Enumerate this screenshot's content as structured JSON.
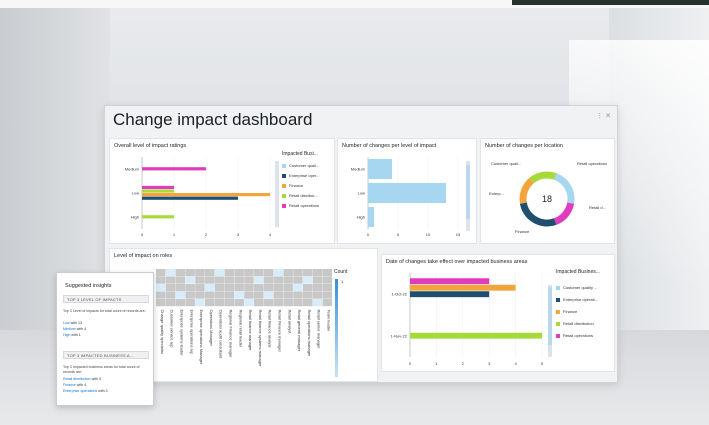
{
  "dashboard": {
    "title": "Change impact dashboard",
    "menu": "⋮ ✕"
  },
  "ratings": {
    "title": "Overall level of impact ratings",
    "legend_title": "Impacted Busi...",
    "legend": [
      "Customer quali...",
      "Enterprise oper...",
      "Finance",
      "Retail distribut...",
      "Retail operations"
    ]
  },
  "changes_impact": {
    "title": "Number of changes per level of impact"
  },
  "changes_location": {
    "title": "Number of changes per location",
    "center_value": "18",
    "labels": {
      "customer": "Customer quali...",
      "retail_ops": "Retail operations",
      "retail_dist": "Retail d...",
      "enterprise": "Enterp...",
      "finance": "Finance"
    }
  },
  "roles": {
    "title": "Level of impact on roles",
    "count_label": "Count",
    "count_value": "1",
    "roles": [
      "Change quality specialist",
      "Customer service rep",
      "Enterprise systems leader",
      "Enterprise operations rep",
      "Enterprise operations Manager",
      "Operations Manager",
      "Operations audit consultant",
      "Regional Finance manager",
      "Regional retail leader",
      "Retail finance manager",
      "Retail finance systems manager",
      "Retail finance analyst",
      "Retail Finance manager",
      "Retail analyst",
      "Retail general manager",
      "Retail operations manager",
      "Retail senior manager",
      "Team leader"
    ]
  },
  "dates": {
    "title": "Date of changes take effect over impacted business areas",
    "legend_title": "Impacted Busines...",
    "legend": [
      "Customer quality ...",
      "Enterprise operati...",
      "Finance",
      "Retail distribution",
      "Retail operations"
    ]
  },
  "insights": {
    "heading": "Suggested insights",
    "chip1": "TOP 3 LEVEL OF IMPACTS",
    "para1": "Top 3 Level of impacts for total count of records are:",
    "l1a": "Low",
    "l1b": " with 13",
    "l2a": "Medium",
    "l2b": " with 4",
    "l3a": "High",
    "l3b": " with 1",
    "chip2": "TOP 3 IMPACTED BUSINESS A...",
    "para2": "Top 3 Impacted business areas for total count of records are:",
    "m1a": "Retail distribution",
    "m1b": " with 5",
    "m2a": "Finance",
    "m2b": " with 4",
    "m3a": "Enterprise operations",
    "m3b": " with 3"
  },
  "colors": {
    "customer": "#a7d7f0",
    "enterprise": "#1f4e6e",
    "finance": "#f2a53a",
    "retail_dist": "#a8d93a",
    "retail_ops": "#e13bc0"
  },
  "chart_data": [
    {
      "type": "bar",
      "title": "Overall level of impact ratings",
      "orientation": "horizontal",
      "categories": [
        "Medium",
        "Low",
        "High"
      ],
      "xticks": [
        "0",
        "1",
        "2",
        "3",
        "4"
      ],
      "legend_title": "Impacted Busi...",
      "series": [
        {
          "name": "Retail operations",
          "values": [
            2,
            1,
            0
          ]
        },
        {
          "name": "Retail distribut...",
          "values": [
            0,
            1,
            1
          ]
        },
        {
          "name": "Finance",
          "values": [
            0,
            4,
            0
          ]
        },
        {
          "name": "Enterprise opera...",
          "values": [
            0,
            3,
            0
          ]
        },
        {
          "name": "Customer quali...",
          "values": [
            0,
            0,
            0
          ]
        }
      ]
    },
    {
      "type": "bar",
      "title": "Number of changes per level of impact",
      "orientation": "horizontal",
      "categories": [
        "Medium",
        "Low",
        "High"
      ],
      "values": [
        4,
        13,
        1
      ],
      "xticks": [
        "0",
        "5",
        "10",
        "15"
      ]
    },
    {
      "type": "pie",
      "title": "Number of changes per location",
      "center_label": "18",
      "labels": [
        "Customer quali...",
        "Retail operations",
        "Retail d...",
        "Finance",
        "Enterp..."
      ],
      "values": [
        4,
        3,
        5,
        3,
        3
      ]
    },
    {
      "type": "bar",
      "title": "Date of changes take effect over impacted business areas",
      "orientation": "horizontal",
      "categories": [
        "1-Oct-22",
        "1-Nov-22"
      ],
      "xticks": [
        "0",
        "1",
        "2",
        "3",
        "4",
        "5"
      ],
      "legend_title": "Impacted Busines...",
      "series": [
        {
          "name": "Retail operations",
          "values": [
            3,
            0
          ]
        },
        {
          "name": "Finance",
          "values": [
            4,
            0
          ]
        },
        {
          "name": "Enterprise operati...",
          "values": [
            3,
            0
          ]
        },
        {
          "name": "Retail distribution",
          "values": [
            0,
            5
          ]
        }
      ]
    }
  ]
}
